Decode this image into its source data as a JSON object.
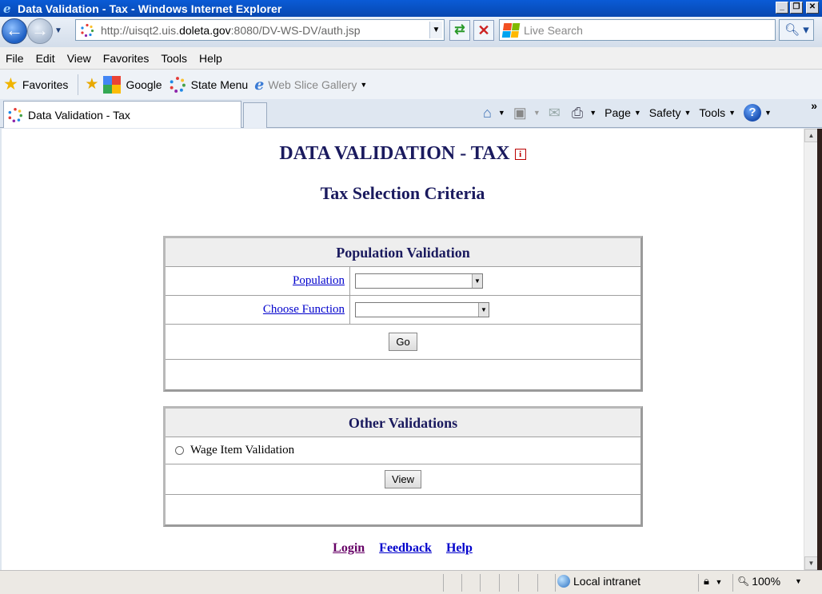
{
  "window": {
    "title": "Data Validation - Tax - Windows Internet Explorer",
    "app_icon": "ie-icon",
    "minimize_glyph": "_",
    "maximize_glyph": "❐",
    "close_glyph": "✕"
  },
  "address": {
    "url_prefix": "http://uisqt2.uis.",
    "url_domain": "doleta.gov",
    "url_suffix": ":8080/DV-WS-DV/auth.jsp",
    "search_placeholder": "Live Search"
  },
  "menu": {
    "items": [
      "File",
      "Edit",
      "View",
      "Favorites",
      "Tools",
      "Help"
    ]
  },
  "favorites_bar": {
    "favorites_label": "Favorites",
    "links": [
      "Google",
      "State Menu"
    ],
    "web_slice": "Web Slice Gallery"
  },
  "tab": {
    "label": "Data Validation - Tax"
  },
  "command_bar": {
    "page": "Page",
    "safety": "Safety",
    "tools": "Tools"
  },
  "page": {
    "title": "DATA VALIDATION - TAX",
    "info_glyph": "i",
    "subtitle": "Tax Selection Criteria",
    "population_panel": {
      "header": "Population Validation",
      "population_label": "Population",
      "population_value": "",
      "function_label": "Choose Function",
      "function_value": "",
      "go_label": "Go"
    },
    "other_panel": {
      "header": "Other Validations",
      "wage_item_label": "Wage Item Validation",
      "view_label": "View"
    },
    "footer": {
      "login": "Login",
      "feedback": "Feedback",
      "help": "Help"
    }
  },
  "status": {
    "zone": "Local intranet",
    "zoom": "100%"
  },
  "colors": {
    "heading": "#1a1a5e",
    "link": "#0000cc",
    "visited_link": "#660066",
    "titlebar": "#0a5bd6"
  }
}
